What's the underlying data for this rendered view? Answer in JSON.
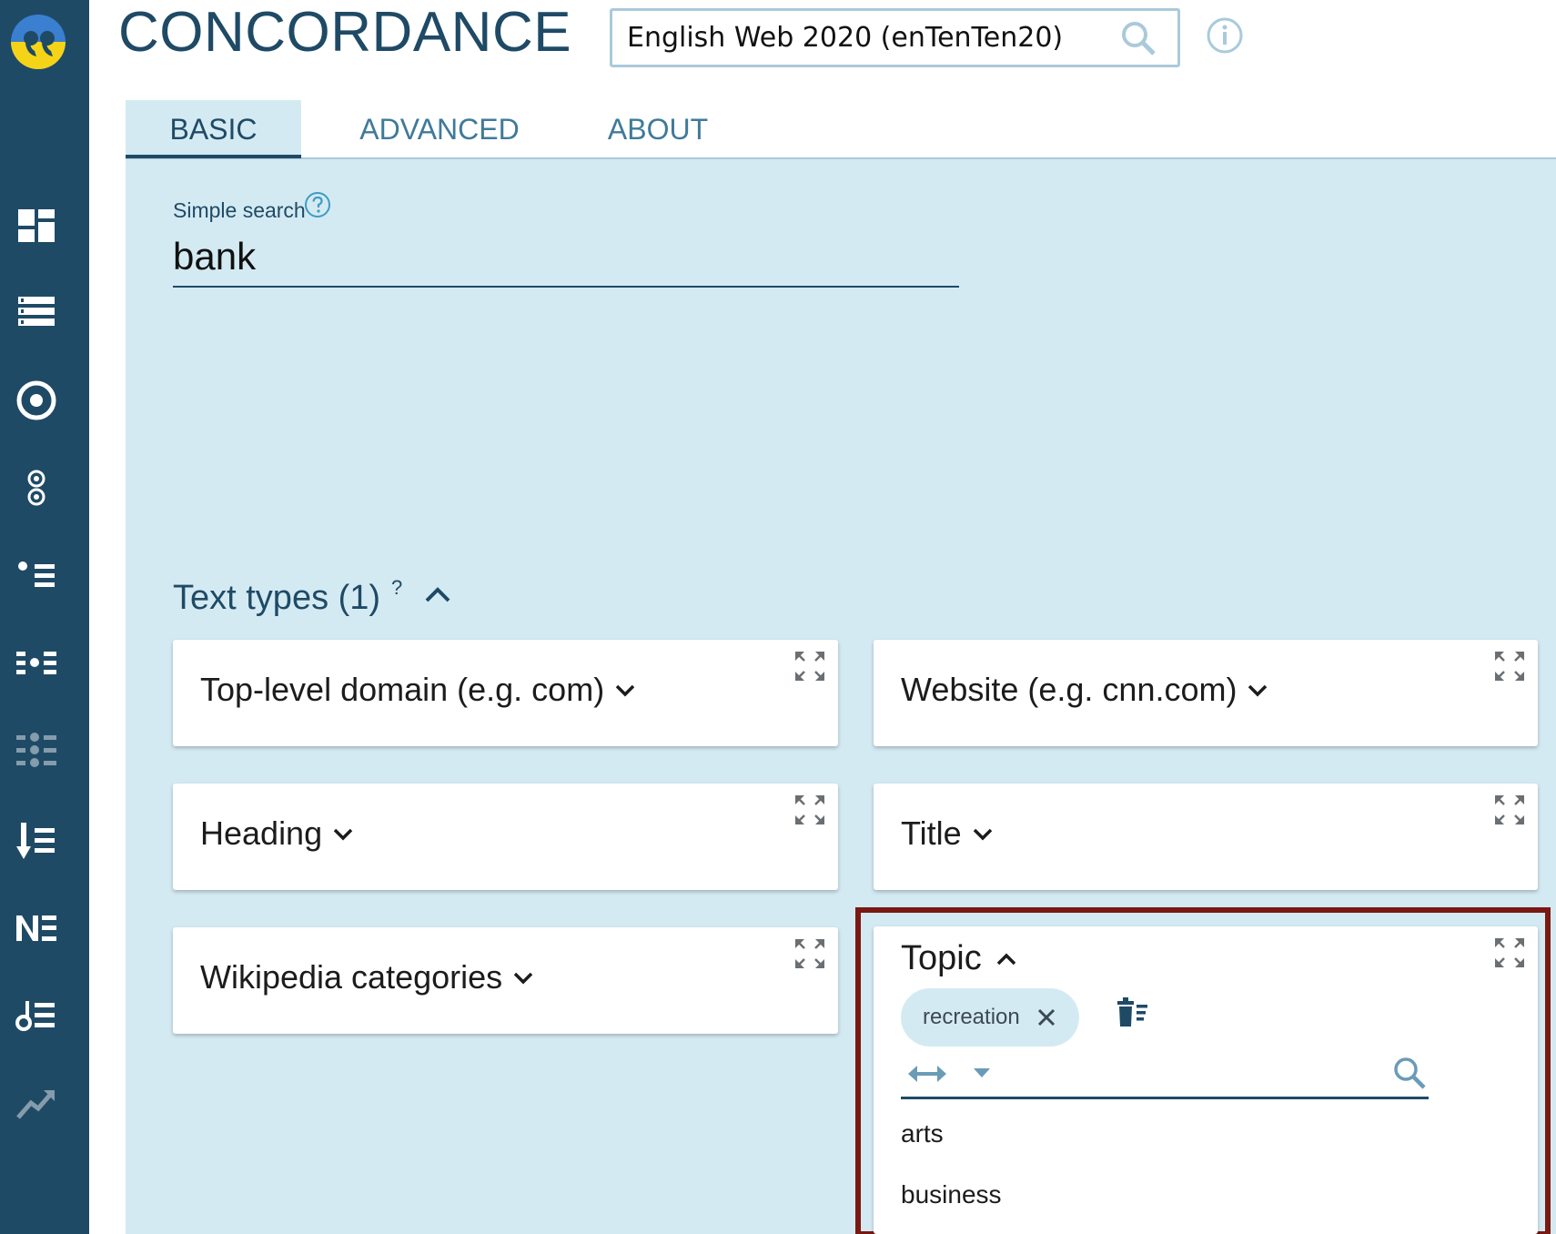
{
  "app": {
    "title": "CONCORDANCE"
  },
  "corpus": {
    "value": "English Web 2020 (enTenTen20)"
  },
  "tabs": [
    {
      "label": "BASIC"
    },
    {
      "label": "ADVANCED"
    },
    {
      "label": "ABOUT"
    }
  ],
  "sidebar": {
    "items": [
      {
        "icon": "dashboard-icon"
      },
      {
        "icon": "list-icon"
      },
      {
        "icon": "target-icon"
      },
      {
        "icon": "double-circle-icon"
      },
      {
        "icon": "wordlist-icon"
      },
      {
        "icon": "ngram-icon"
      },
      {
        "icon": "keywords-icon"
      },
      {
        "icon": "sort-list-icon"
      },
      {
        "icon": "ne-icon"
      },
      {
        "icon": "numbered-list-icon"
      },
      {
        "icon": "trends-icon"
      }
    ]
  },
  "search": {
    "label": "Simple search",
    "value": "bank"
  },
  "text_types": {
    "heading": "Text types (1)",
    "help": "?",
    "cards": [
      {
        "label": "Top-level domain (e.g. com)"
      },
      {
        "label": "Website (e.g. cnn.com)"
      },
      {
        "label": "Heading"
      },
      {
        "label": "Title"
      },
      {
        "label": "Wikipedia categories"
      }
    ],
    "topic": {
      "label": "Topic",
      "chip": "recreation",
      "options": [
        "arts",
        "business"
      ]
    }
  },
  "colors": {
    "sidebar": "#1f4a66",
    "panel": "#d4eaf3",
    "accent": "#1f4a66",
    "logo_yellow": "#f5d418",
    "logo_blue": "#3a7fd0",
    "highlight_border": "#7a1812"
  }
}
